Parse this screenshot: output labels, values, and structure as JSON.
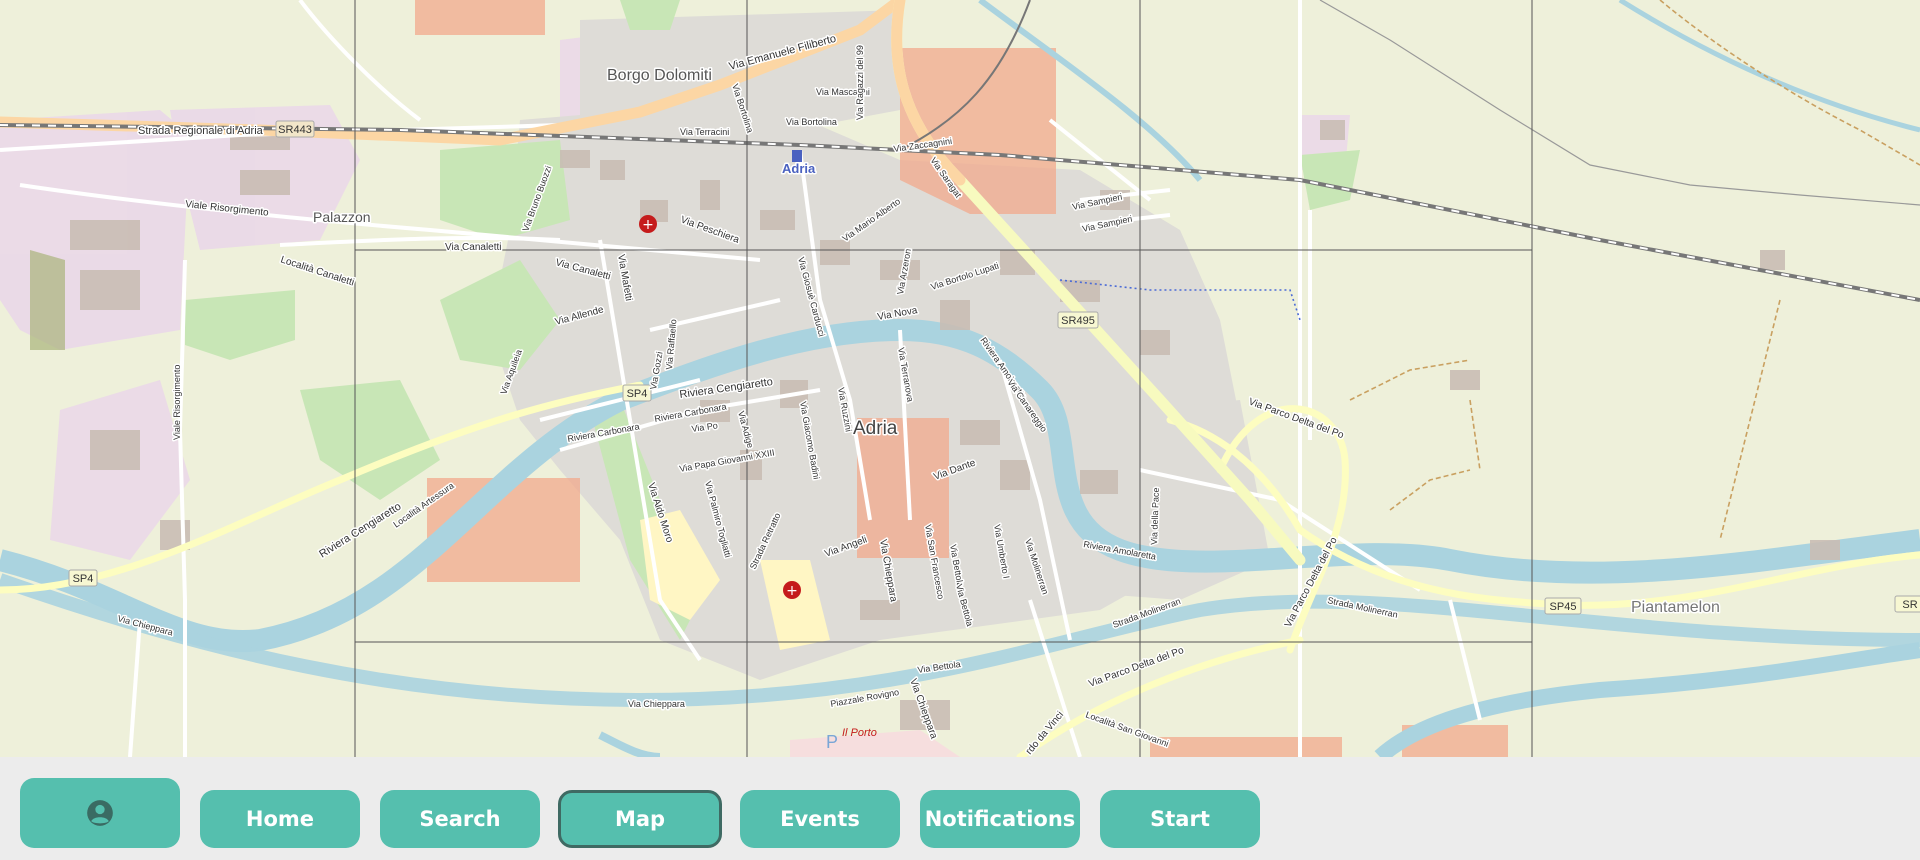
{
  "map": {
    "labels": {
      "city": "Adria",
      "borgo": "Borgo Dolomiti",
      "palazzon": "Palazzon",
      "piantamelon": "Piantamelon",
      "station": "Adria",
      "porto": "Il Porto",
      "sr443_name": "Strada Regionale di Adria",
      "sr443": "SR443",
      "sr495": "SR495",
      "sp4_a": "SP4",
      "sp4_b": "SP4",
      "sp45": "SP45",
      "sr_edge": "SR",
      "emanuele": "Via Emanuele Filiberto",
      "risorgimento": "Viale Risorgimento",
      "canaletti_loc": "Località Canaletti",
      "canaletti": "Via Canaletti",
      "canaletti2": "Via Canaletti",
      "peschiera": "Via Peschiera",
      "terracini": "Via Terracini",
      "mascagni": "Via Mascagni",
      "bortolina": "Via Bortolina",
      "bortolina2": "Via Bortolina",
      "zaccagnini": "Via Zaccagnini",
      "saragat": "Via Saragat",
      "ragazzi": "Via Ragazzi del 99",
      "sampieri": "Via Sampieri",
      "sampieri2": "Via Sampieri",
      "bruno_buozzi": "Via Bruno Buozzi",
      "mafetti": "Via Mafetti",
      "allende": "Via Allende",
      "aquileia": "Via Aquileia",
      "gozzi": "Via Gozzi",
      "raffaello": "Via Raffaello",
      "riviera_cengiaretto": "Riviera Cengiaretto",
      "riviera_cengiaretto2": "Riviera Cengiaretto",
      "riviera_carbonara": "Riviera Carbonara",
      "riviera_carbonara2": "Riviera Carbonara",
      "vio_po": "Via Po",
      "vie_adige": "Via Adige",
      "papa": "Via Papa Giovanni XXIII",
      "badini": "Via Giacomo Badini",
      "aldo_moro": "Via Aldo Moro",
      "tagliaferri": "Via Palmiro Togliatti",
      "retratto": "Strada Retratto",
      "angeli": "Via Angeli",
      "chieppara": "Via Chieppara",
      "chieppara2": "Via Chieppara",
      "chieppara3": "Via Chieppara",
      "chieppara4": "Via Chieppara",
      "bettola": "Via Bettola",
      "bettola2": "Via Bettola",
      "bettola3": "Via Bettola",
      "san_francesco": "Via San Francesco",
      "umberto": "Via Umberto I",
      "molinerrari": "Via Molinerran",
      "dante": "Via Dante",
      "nova": "Via Nova",
      "terranova": "Via Terranova",
      "ruzzini": "Via Ruzzini",
      "carducci": "Via Giosuè Carducci",
      "mario": "Via Mario Alberto",
      "arzeron": "Via Arzeron",
      "bortolo": "Via Bortolo Lupati",
      "amolaretta": "Riviera Amolaretta",
      "amolaretta2": "Riviera Amolaretta",
      "canareggio": "Via Canareggio",
      "parco_po": "Via Parco Delta del Po",
      "parco_po2": "Via Parco Delta del Po",
      "parco_po3": "Via Parco Delta del Po",
      "strada_molinerran": "Strada Molinerran",
      "strada_molinerran2": "Strada Molinerran",
      "della_pace": "Via della Pace",
      "artessura": "Località Artessura",
      "rovigno": "Piazzale Rovigno",
      "san_giovanni": "Località San Giovanni",
      "da_vinci": "rdo da Vinci",
      "parking": "P"
    }
  },
  "toolbar": {
    "profile_icon": "account-circle-icon",
    "home": "Home",
    "search": "Search",
    "map": "Map",
    "events": "Events",
    "notifications": "Notifications",
    "start": "Start",
    "active": "map"
  },
  "colors": {
    "button": "#55bfae",
    "button_active_border": "#3f6a63",
    "toolbar_bg": "#ececec",
    "water": "#aad3df",
    "highlight": "#f2a98c"
  }
}
